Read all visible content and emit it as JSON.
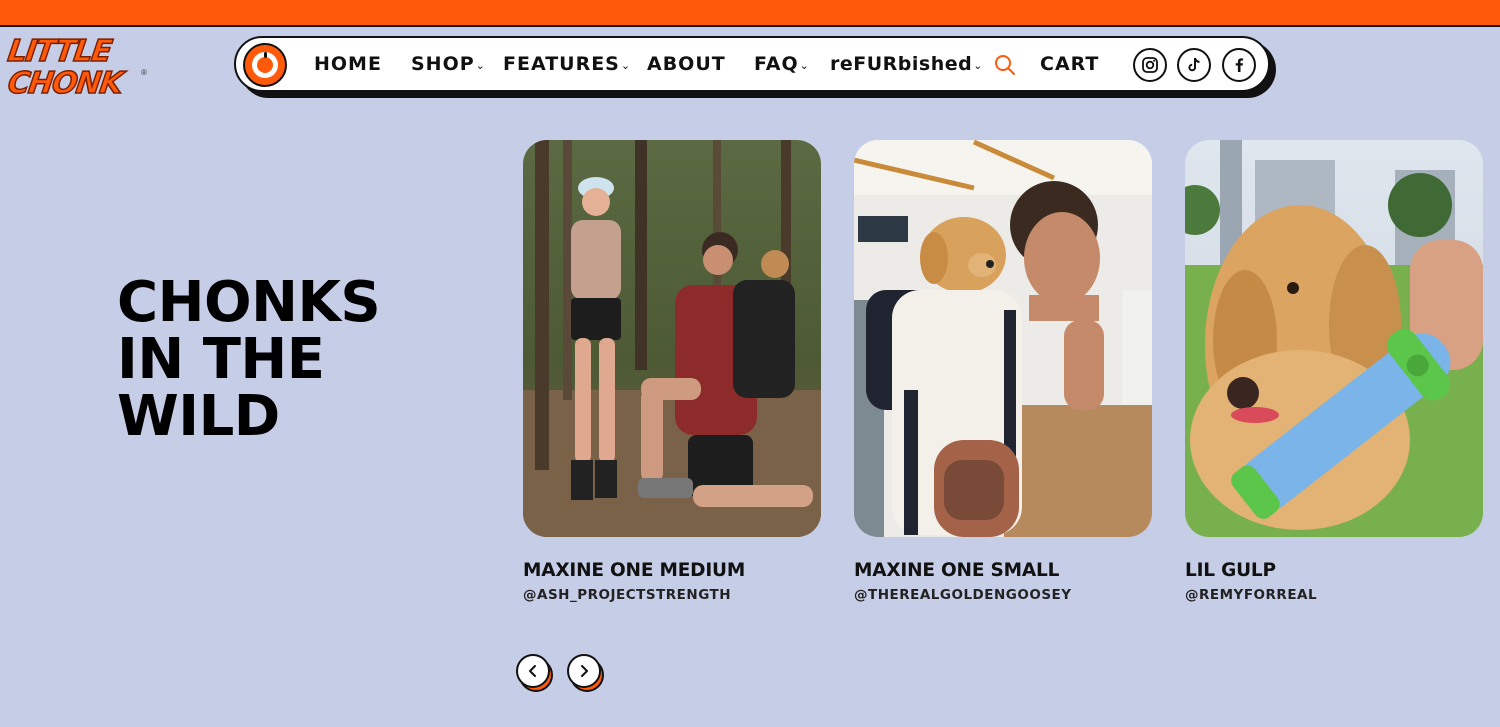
{
  "brand": {
    "logo_line1": "LITTLE",
    "logo_line2": "CHONK",
    "logo_reg": "®",
    "accent": "#ff5a0a",
    "background": "#c6cde7"
  },
  "nav": {
    "items": [
      {
        "label": "HOME"
      },
      {
        "label": "SHOP",
        "chevron": "⌄"
      },
      {
        "label": "FEATURES",
        "chevron": "⌄"
      },
      {
        "label": "ABOUT"
      },
      {
        "label": "FAQ",
        "chevron": "⌄"
      },
      {
        "label": "reFURbished",
        "chevron": "⌄"
      },
      {
        "label": "CART"
      }
    ],
    "icons": [
      "home-badge-icon",
      "search-icon",
      "instagram-icon",
      "tiktok-icon",
      "facebook-icon"
    ]
  },
  "hero": {
    "line1": "CHONKS",
    "line2": "IN THE",
    "line3": "WILD"
  },
  "cards": [
    {
      "title": "MAXINE ONE MEDIUM",
      "handle": "@ASH_PROJECTSTRENGTH"
    },
    {
      "title": "MAXINE ONE SMALL",
      "handle": "@THEREALGOLDENGOOSEY"
    },
    {
      "title": "LIL GULP",
      "handle": "@REMYFORREAL"
    }
  ],
  "carousel": {
    "prev_icon": "chevron-left-icon",
    "next_icon": "chevron-right-icon"
  }
}
